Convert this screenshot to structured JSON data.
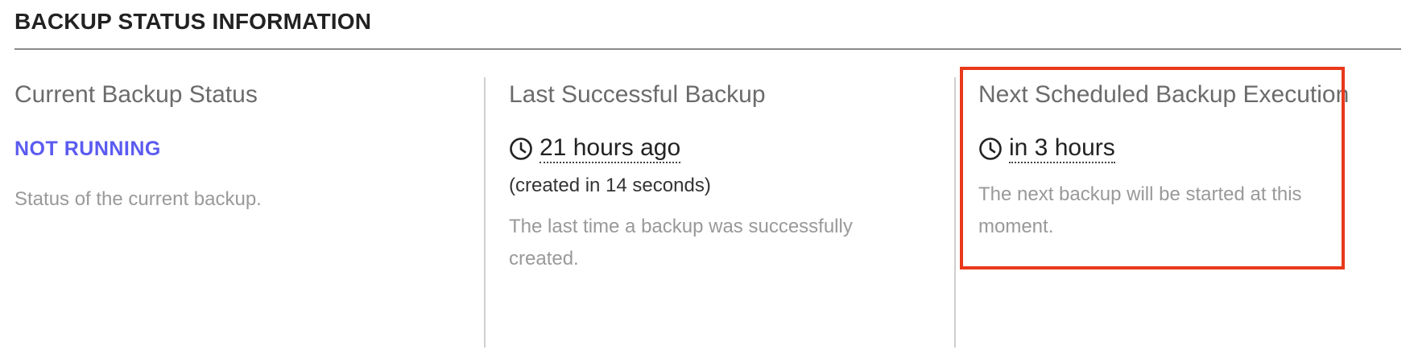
{
  "section": {
    "title": "BACKUP STATUS INFORMATION"
  },
  "columns": [
    {
      "heading": "Current Backup Status",
      "status": "NOT RUNNING",
      "description": "Status of the current backup."
    },
    {
      "heading": "Last Successful Backup",
      "time": "21 hours ago",
      "icon": "clock-icon",
      "duration": "(created in 14 seconds)",
      "description": "The last time a backup was successfully created."
    },
    {
      "heading": "Next Scheduled Backup Execution",
      "time": "in 3 hours",
      "icon": "clock-icon",
      "description": "The next backup will be started at this moment."
    }
  ],
  "colors": {
    "status_not_running": "#5b5bf0",
    "highlight": "#e8391b",
    "muted_text": "#999999",
    "heading_text": "#6b6b6b"
  }
}
